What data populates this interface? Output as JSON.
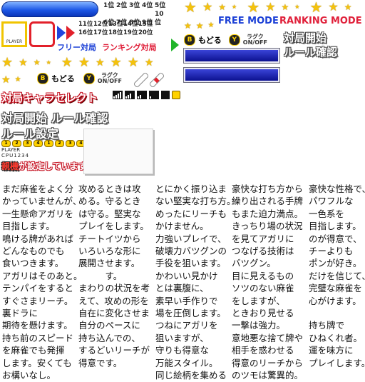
{
  "ranks": {
    "row1": [
      "1位",
      "2位",
      "3位",
      "4位",
      "5位"
    ],
    "row2": [
      "6位",
      "7位",
      "8位",
      "9位",
      "10位"
    ],
    "row3": [
      "11位",
      "12位",
      "13位",
      "14位",
      "15位"
    ],
    "row4": [
      "16位",
      "17位",
      "18位",
      "19位",
      "20位"
    ]
  },
  "player_label": "PLAYER",
  "mode_tabs": {
    "free": "フリー対局",
    "ranking": "ランキング対局"
  },
  "mode_en": {
    "free": "FREE MODE",
    "ranking": "RANKING MODE"
  },
  "buttons": {
    "b_icon": "B",
    "b_label": "もどる",
    "y_icon": "Y",
    "y_label_top": "ラグク",
    "y_label_bottom": "ON/OFF"
  },
  "menu_titles": {
    "start": "対局開始",
    "rules": "ルール確認"
  },
  "char_select_title": "対局キャラセレクト",
  "header_line": "対局開始 ルール確認",
  "rules_setting": "ルール設定",
  "number_badges": [
    "1",
    "2",
    "3",
    "4",
    "1",
    "2",
    "3",
    "4"
  ],
  "player_small": "PLAYER",
  "cpu_small": "CPU1234",
  "host_notice": {
    "emph": "親機",
    "rest": "が設定しています"
  },
  "columns": [
    [
      "まだ麻雀をよく分",
      "かっていませんが、",
      "一生懸命アガリを",
      "目指します。",
      "鳴ける牌があれば",
      "どんなものでも",
      "食いつきます。",
      "アガリはそのあと。",
      "テンパイをすると",
      "すぐさまリーチ。",
      "裏ドラに",
      "期待を懸けます。",
      "持ち前のスピード",
      "を麻雀でも発揮",
      "します。安くても",
      "お構いなし。"
    ],
    [
      "攻めるときは攻",
      "める。守るとき",
      "は守る。堅実な",
      "プレイをします。",
      "チートイツから",
      "いろいろな形に",
      "展開させます。",
      "　　　す。",
      "まわりの状況を考",
      "えて、攻めの形を",
      "自在に変化させま",
      "自分のペースに",
      "持ち込んでの、",
      "するどいリーチが",
      "得意です。",
      ""
    ],
    [
      "とにかく振り込ま",
      "ない堅実な打ち方。",
      "めったにリーチも",
      "かけません。",
      "力強いプレイで、",
      "破壊力バツグンの",
      "手役を狙います。",
      "かわいい見かけ",
      "とは裏腹に、",
      "素早い手作りで",
      "場を圧倒します。",
      "つねにアガリを",
      "狙いますが、",
      "守りも得意な",
      "万能スタイル。",
      "同じ絵柄を集める"
    ],
    [
      "豪快な打ち方から",
      "繰り出される手牌",
      "もまた迫力満点。",
      "きっちり場の状況",
      "を見てアガリに",
      "つなげる技術は",
      "バツグン。",
      "目に見えるもの",
      "ソツのない麻雀",
      "をしますが、",
      "ときおり見せる",
      "一撃は強力。",
      "意地悪な捨て牌や",
      "相手を惑わせる",
      "得意のリーチから",
      "のツモは驚異的。"
    ],
    [
      "豪快な性格で、",
      "パワフルな",
      "一色系を",
      "目指します。",
      "のが得意で、",
      "チーよりも",
      "ポンが好き。",
      "だけを信じて、",
      "完璧な麻雀を",
      "心がけます。",
      "",
      "持ち牌で",
      "ひねくれ者。",
      "運を味方に",
      "プレイします。",
      ""
    ]
  ]
}
